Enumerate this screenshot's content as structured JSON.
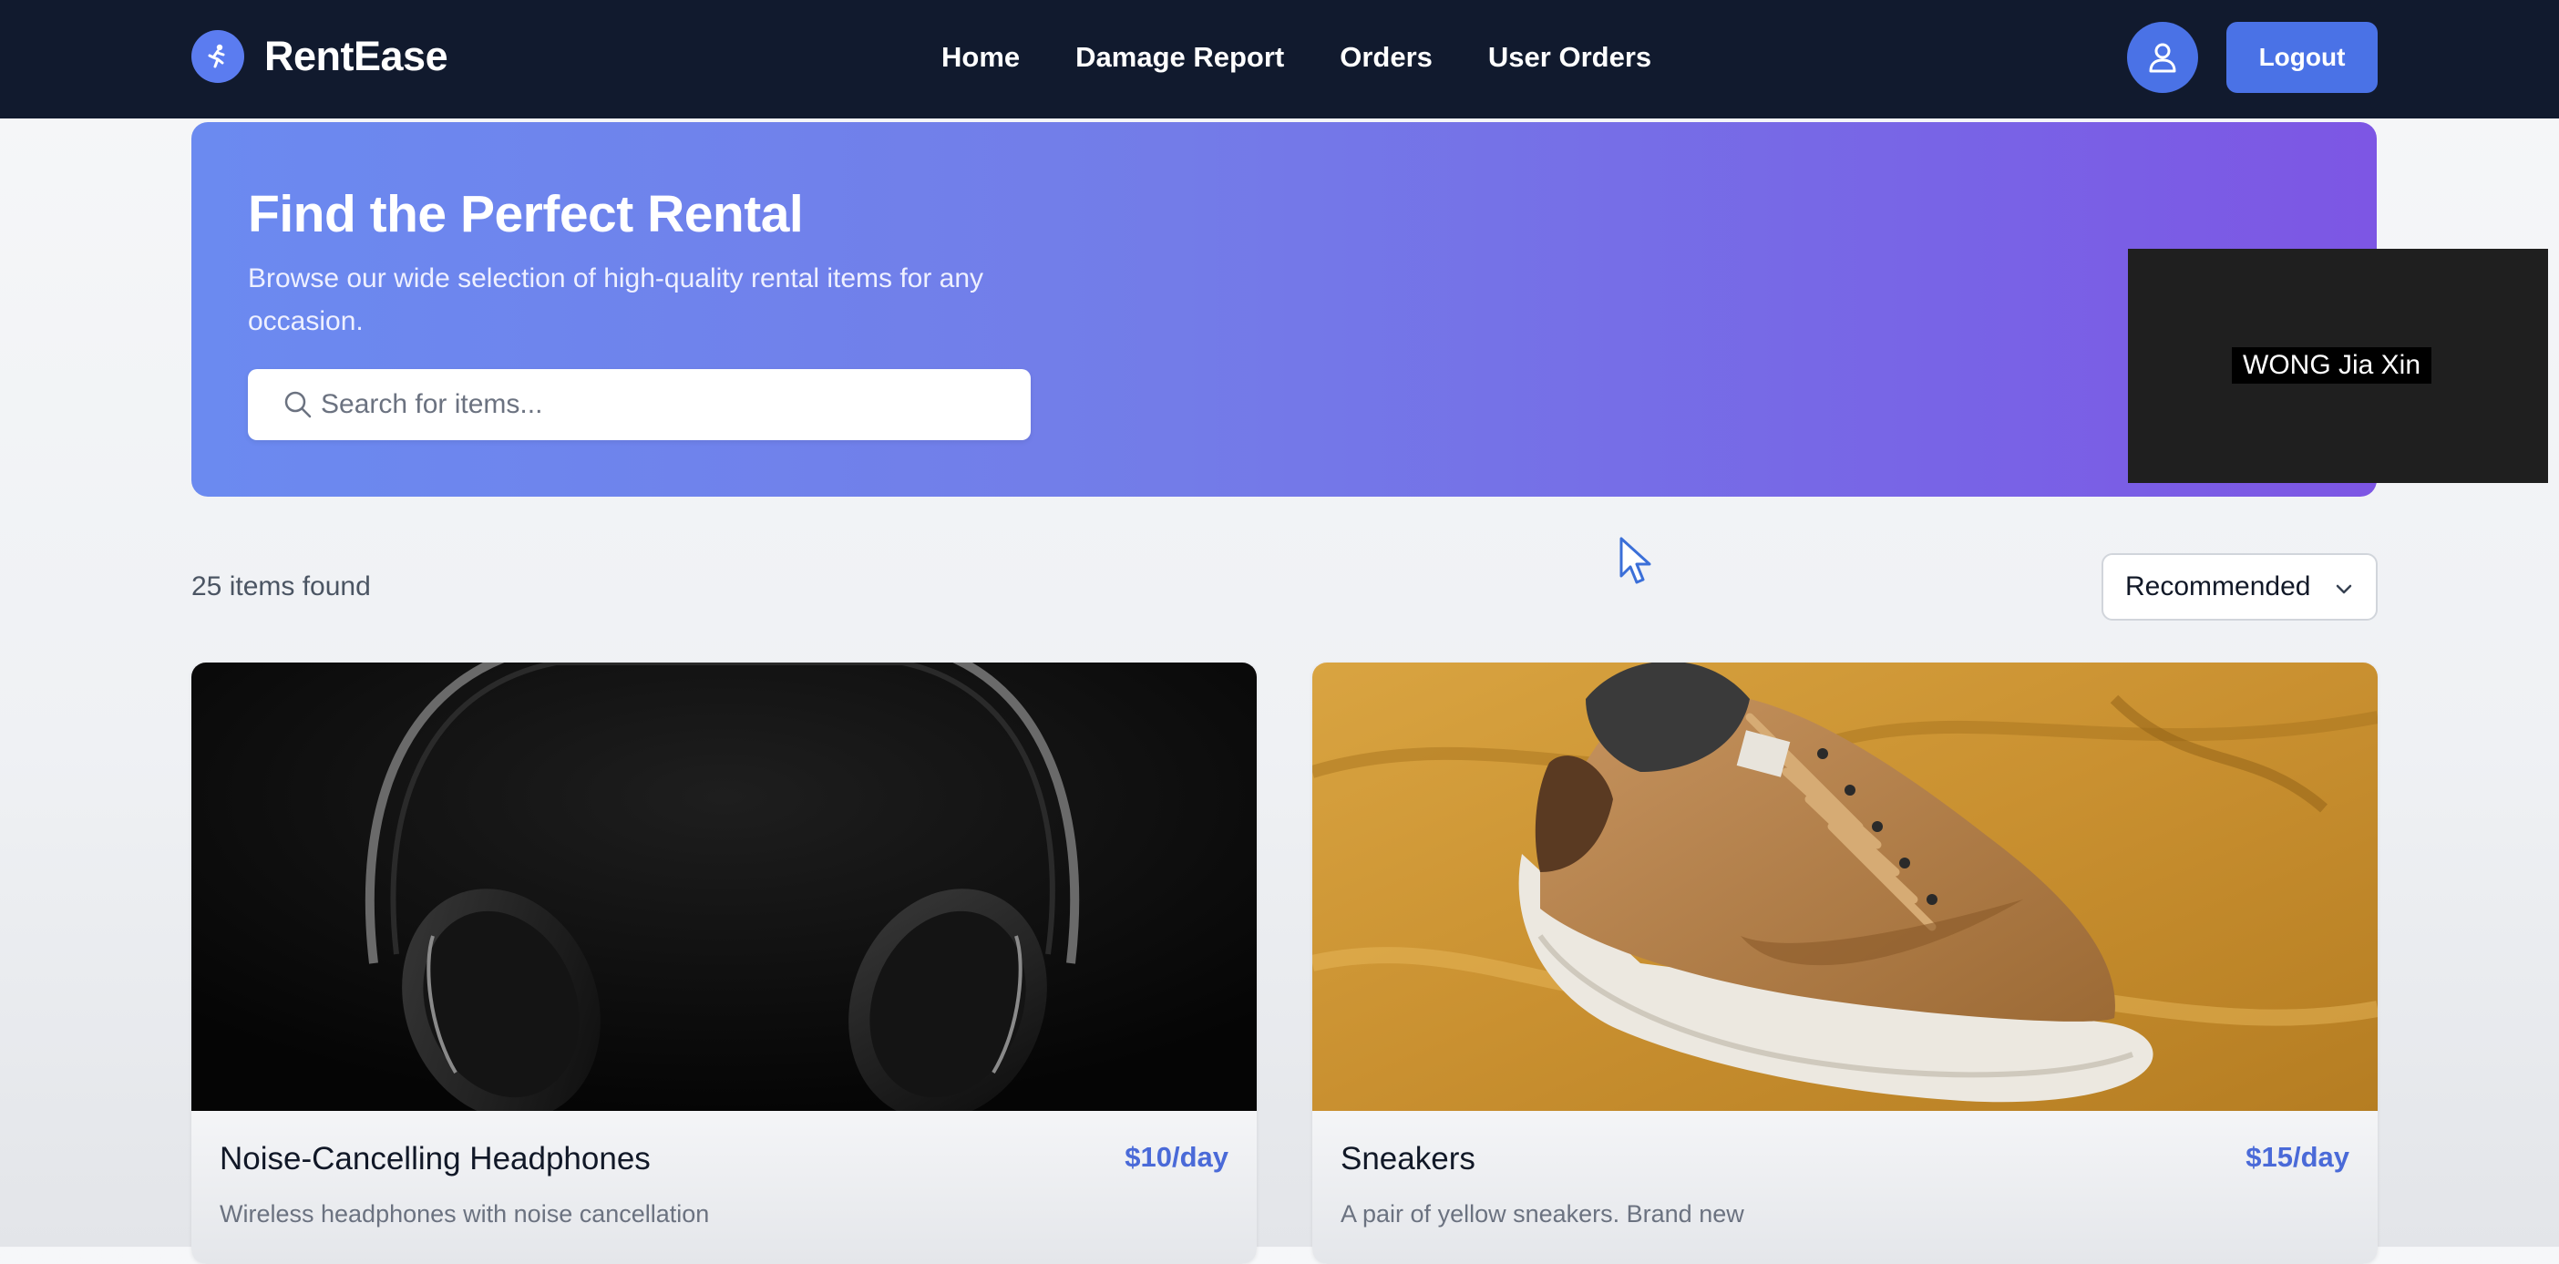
{
  "navbar": {
    "brand": "RentEase",
    "links": [
      "Home",
      "Damage Report",
      "Orders",
      "User Orders"
    ],
    "logout_label": "Logout"
  },
  "hero": {
    "title": "Find the Perfect Rental",
    "subtitle": "Browse our wide selection of high-quality rental items for any occasion.",
    "search_placeholder": "Search for items..."
  },
  "video_overlay": {
    "participant_name": "WONG Jia Xin"
  },
  "results": {
    "count_text": "25 items found",
    "sort_selected": "Recommended"
  },
  "items": [
    {
      "name": "Noise-Cancelling Headphones",
      "price": "$10/day",
      "description": "Wireless headphones with noise cancellation",
      "image": "black-headphones-photo"
    },
    {
      "name": "Sneakers",
      "price": "$15/day",
      "description": "A pair of yellow sneakers. Brand new",
      "image": "tan-sneaker-on-mustard-fabric-photo"
    }
  ],
  "colors": {
    "navbar_bg": "#111a2e",
    "accent": "#4a72e6",
    "price": "#4a6ad8",
    "hero_gradient_start": "#6b8af0",
    "hero_gradient_end": "#7d56e4"
  },
  "icons": [
    "logo-icon",
    "user-icon",
    "search-icon",
    "chevron-down-icon",
    "mouse-pointer-icon"
  ]
}
